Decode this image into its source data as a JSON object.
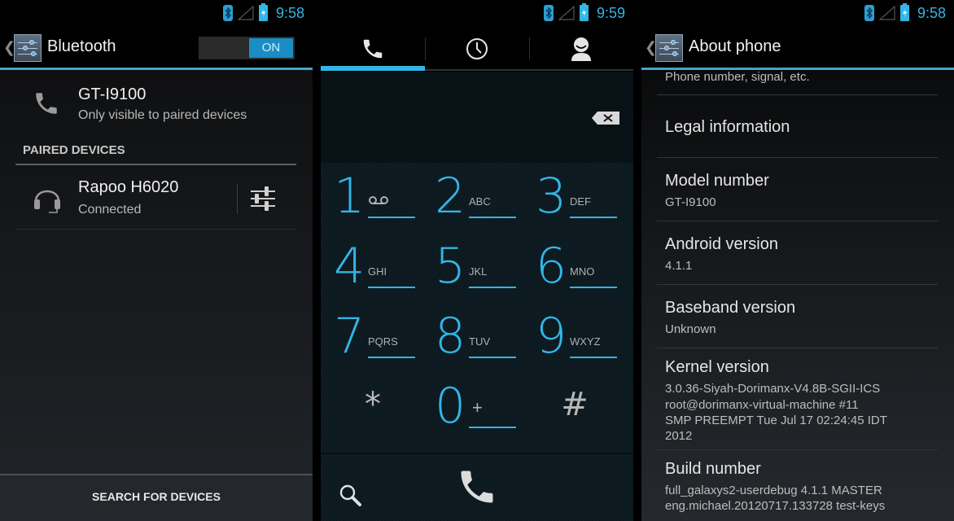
{
  "bluetooth_screen": {
    "status_bar": {
      "time": "9:58",
      "icons": [
        "bluetooth-icon",
        "signal-icon",
        "battery-charging-icon"
      ]
    },
    "action_bar": {
      "title": "Bluetooth",
      "toggle": {
        "state": "ON"
      }
    },
    "this_device": {
      "name": "GT-I9100",
      "visibility": "Only visible to paired devices",
      "icon": "phone-icon"
    },
    "paired_section_header": "PAIRED DEVICES",
    "paired_devices": [
      {
        "name": "Rapoo H6020",
        "status": "Connected",
        "icon": "headset-icon"
      }
    ],
    "bottom_button": "SEARCH FOR DEVICES"
  },
  "dialer_screen": {
    "status_bar": {
      "time": "9:59",
      "icons": [
        "bluetooth-icon",
        "signal-icon",
        "battery-charging-icon"
      ]
    },
    "tabs": [
      {
        "name": "phone",
        "icon": "phone-icon",
        "selected": true
      },
      {
        "name": "call-log",
        "icon": "clock-icon",
        "selected": false
      },
      {
        "name": "contacts",
        "icon": "contact-icon",
        "selected": false
      }
    ],
    "digits": "",
    "keys": [
      {
        "digit": "1",
        "letters": "",
        "icon": "voicemail-icon"
      },
      {
        "digit": "2",
        "letters": "ABC"
      },
      {
        "digit": "3",
        "letters": "DEF"
      },
      {
        "digit": "4",
        "letters": "GHI"
      },
      {
        "digit": "5",
        "letters": "JKL"
      },
      {
        "digit": "6",
        "letters": "MNO"
      },
      {
        "digit": "7",
        "letters": "PQRS"
      },
      {
        "digit": "8",
        "letters": "TUV"
      },
      {
        "digit": "9",
        "letters": "WXYZ"
      },
      {
        "digit": "*",
        "letters": ""
      },
      {
        "digit": "0",
        "letters": "+"
      },
      {
        "digit": "#",
        "letters": ""
      }
    ]
  },
  "about_screen": {
    "status_bar": {
      "time": "9:58",
      "icons": [
        "bluetooth-icon",
        "signal-icon",
        "battery-charging-icon"
      ]
    },
    "action_bar": {
      "title": "About phone"
    },
    "partial_item_summary": "Phone number, signal, etc.",
    "items": [
      {
        "title": "Legal information",
        "summary": []
      },
      {
        "title": "Model number",
        "summary": [
          "GT-I9100"
        ]
      },
      {
        "title": "Android version",
        "summary": [
          "4.1.1"
        ]
      },
      {
        "title": "Baseband version",
        "summary": [
          "Unknown"
        ]
      },
      {
        "title": "Kernel version",
        "summary": [
          "3.0.36-Siyah-Dorimanx-V4.8B-SGII-ICS",
          "root@dorimanx-virtual-machine #11",
          "SMP PREEMPT Tue Jul 17 02:24:45 IDT",
          "2012"
        ]
      },
      {
        "title": "Build number",
        "summary": [
          "full_galaxys2-userdebug 4.1.1 MASTER",
          "eng.michael.20120717.133728 test-keys"
        ]
      }
    ]
  },
  "colors": {
    "accent": "#33b5e5",
    "toggle_on": "#1a8dc3",
    "actionbar_underline": "#4aa3c8"
  }
}
